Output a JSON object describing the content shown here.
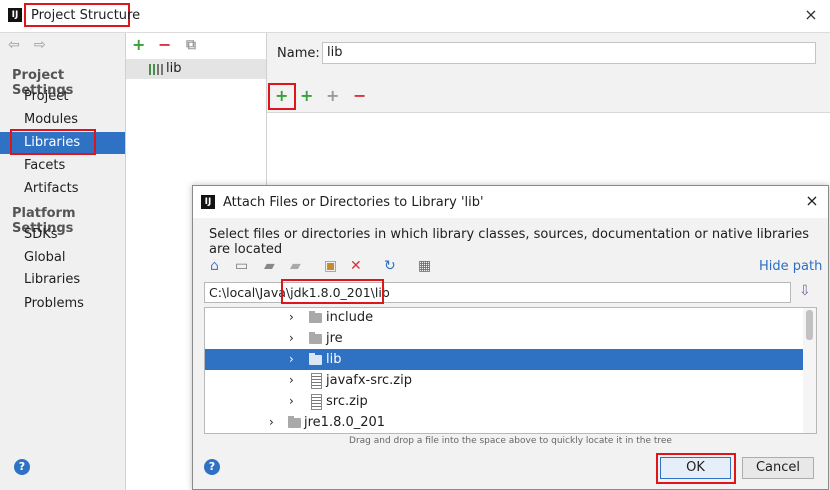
{
  "main": {
    "title": "Project Structure",
    "logo_text": "IJ",
    "close_glyph": "×",
    "nav": {
      "back_glyph": "⇦",
      "forward_glyph": "⇨",
      "project_settings_header": "Project Settings",
      "project_settings_items": [
        {
          "label": "Project"
        },
        {
          "label": "Modules"
        },
        {
          "label": "Libraries"
        },
        {
          "label": "Facets"
        },
        {
          "label": "Artifacts"
        }
      ],
      "selected_item": "Libraries",
      "platform_settings_header": "Platform Settings",
      "platform_settings_items": [
        {
          "label": "SDKs"
        },
        {
          "label": "Global Libraries"
        }
      ],
      "problems_label": "Problems"
    },
    "libraries_list": {
      "add_glyph": "+",
      "remove_glyph": "−",
      "copy_glyph": "⧉",
      "items": [
        {
          "label": "lib"
        }
      ]
    },
    "detail": {
      "name_label": "Name:",
      "name_value": "lib",
      "add_glyph": "+",
      "add_special_glyph": "+",
      "add_alt_glyph": "+",
      "remove_glyph": "−"
    },
    "help_glyph": "?"
  },
  "dialog": {
    "title": "Attach Files or Directories to Library 'lib'",
    "logo_text": "IJ",
    "close_glyph": "×",
    "description": "Select files or directories in which library classes, sources, documentation or native libraries are located",
    "toolbar_icons": [
      "home-icon",
      "desktop-icon",
      "new-folder-icon",
      "project-folder-icon",
      "module-folder-icon",
      "delete-icon",
      "refresh-icon",
      "toggle-hidden-icon"
    ],
    "hide_path_label": "Hide path",
    "path_value": "C:\\local\\Java\\jdk1.8.0_201\\lib",
    "tree_items": [
      {
        "label": "include",
        "kind": "folder",
        "selected": false
      },
      {
        "label": "jre",
        "kind": "folder",
        "selected": false
      },
      {
        "label": "lib",
        "kind": "folder",
        "selected": true
      },
      {
        "label": "javafx-src.zip",
        "kind": "zip",
        "selected": false
      },
      {
        "label": "src.zip",
        "kind": "zip",
        "selected": false
      },
      {
        "label": "jre1.8.0_201",
        "kind": "folder",
        "selected": false
      }
    ],
    "drag_drop_hint": "Drag and drop a file into the space above to quickly locate it in the tree",
    "ok_label": "OK",
    "cancel_label": "Cancel",
    "help_glyph": "?",
    "chevron_glyph": "›"
  },
  "colors": {
    "selection": "#2f72c4",
    "highlight_box": "#e0151b",
    "add_green": "#3a9e3a",
    "remove_red": "#d6343d",
    "link": "#2e6fc0"
  }
}
